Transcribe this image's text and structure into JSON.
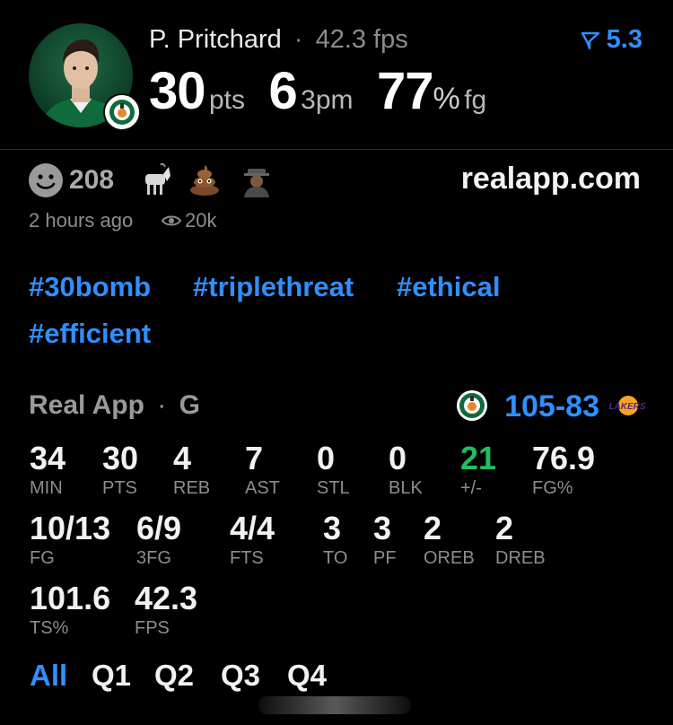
{
  "header": {
    "player_name": "P. Pritchard",
    "separator": "·",
    "fps_label": "42.3 fps",
    "rating": "5.3",
    "points": "30",
    "points_unit": "pts",
    "threes": "6",
    "threes_unit": "3pm",
    "fg_pct": "77",
    "pct_sign": "%",
    "fg_unit": "fg"
  },
  "social": {
    "reaction_count": "208",
    "site": "realapp.com",
    "time_ago": "2 hours ago",
    "views": "20k",
    "reaction_icons": [
      "smiley-icon",
      "goat-icon",
      "poop-icon",
      "detective-icon"
    ]
  },
  "hashtags": [
    "#30bomb",
    "#triplethreat",
    "#ethical",
    "#efficient"
  ],
  "game": {
    "league": "Real App",
    "position": "G",
    "separator": "·",
    "home_score": "105",
    "dash": "-",
    "away_score": "83",
    "home_team": "Celtics",
    "away_team": "LAKERS"
  },
  "stats": {
    "row1": [
      {
        "value": "34",
        "label": "MIN"
      },
      {
        "value": "30",
        "label": "PTS"
      },
      {
        "value": "4",
        "label": "REB"
      },
      {
        "value": "7",
        "label": "AST"
      },
      {
        "value": "0",
        "label": "STL"
      },
      {
        "value": "0",
        "label": "BLK"
      },
      {
        "value": "21",
        "label": "+/-"
      },
      {
        "value": "76.9",
        "label": "FG%"
      }
    ],
    "row2": [
      {
        "value": "10/13",
        "label": "FG"
      },
      {
        "value": "6/9",
        "label": "3FG"
      },
      {
        "value": "4/4",
        "label": "FTS"
      },
      {
        "value": "3",
        "label": "TO"
      },
      {
        "value": "3",
        "label": "PF"
      },
      {
        "value": "2",
        "label": "OREB"
      },
      {
        "value": "2",
        "label": "DREB"
      }
    ],
    "row3": [
      {
        "value": "101.6",
        "label": "TS%"
      },
      {
        "value": "42.3",
        "label": "FPS"
      }
    ]
  },
  "tabs": [
    "All",
    "Q1",
    "Q2",
    "Q3",
    "Q4"
  ],
  "colors": {
    "accent": "#2f8fff",
    "positive": "#1fbf5f",
    "celtics_green": "#0f6b3c"
  }
}
